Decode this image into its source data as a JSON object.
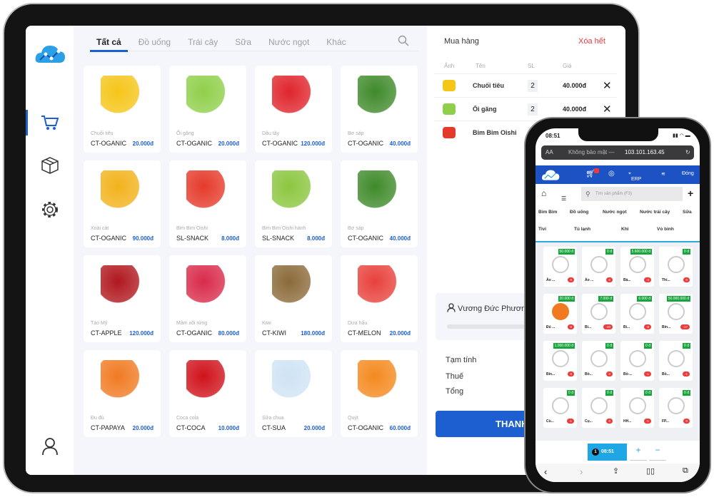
{
  "colors": {
    "accent": "#1d5fd1",
    "danger": "#f03a3a",
    "price_badge": "#17a63c",
    "phone_nav": "#1d52c4"
  },
  "sidebar": {
    "items": [
      {
        "icon": "cart-icon",
        "active": true
      },
      {
        "icon": "box-icon"
      },
      {
        "icon": "gear-icon"
      }
    ],
    "bottom_icon": "user-icon"
  },
  "tabs": [
    "Tất cả",
    "Đồ uống",
    "Trái cây",
    "Sữa",
    "Nước ngọt",
    "Khác"
  ],
  "products": [
    {
      "name": "Chuối tiêu",
      "code": "CT-OGANIC",
      "price": "20.000đ",
      "color": "#f5c518"
    },
    {
      "name": "Ổi găng",
      "code": "CT-OGANIC",
      "price": "20.000đ",
      "color": "#8fcf4a"
    },
    {
      "name": "Dâu tây",
      "code": "CT-OGANIC",
      "price": "120.000đ",
      "color": "#e0242c"
    },
    {
      "name": "Bơ sáp",
      "code": "CT-OGANIC",
      "price": "40.000đ",
      "color": "#3f8a2a"
    },
    {
      "name": "Xoài cát",
      "code": "CT-OGANIC",
      "price": "90.000đ",
      "color": "#f2b21b"
    },
    {
      "name": "Bim Bim Oishi",
      "code": "SL-SNACK",
      "price": "8.000đ",
      "color": "#e53a2a"
    },
    {
      "name": "Bim Bim Oishi hành",
      "code": "SL-SNACK",
      "price": "8.000đ",
      "color": "#8cc63f"
    },
    {
      "name": "Bơ sáp",
      "code": "CT-OGANIC",
      "price": "40.000đ",
      "color": "#3f8a2a"
    },
    {
      "name": "Táo Mỹ",
      "code": "CT-APPLE",
      "price": "120.000đ",
      "color": "#b0181e"
    },
    {
      "name": "Mâm xôi rừng",
      "code": "CT-OGANIC",
      "price": "80.000đ",
      "color": "#d92b4a"
    },
    {
      "name": "Kiwi",
      "code": "CT-KIWI",
      "price": "180.000đ",
      "color": "#8b6a3a"
    },
    {
      "name": "Dưa hấu",
      "code": "CT-MELON",
      "price": "20.000đ",
      "color": "#e8413c"
    },
    {
      "name": "Đu đủ",
      "code": "CT-PAPAYA",
      "price": "20.000đ",
      "color": "#f07a22"
    },
    {
      "name": "Coca cola",
      "code": "CT-COCA",
      "price": "10.000đ",
      "color": "#d0121b"
    },
    {
      "name": "Sữa chua",
      "code": "CT-SUA",
      "price": "20.000đ",
      "color": "#cfe3f5"
    },
    {
      "name": "Quýt",
      "code": "CT-OGANIC",
      "price": "60.000đ",
      "color": "#f4891f"
    }
  ],
  "cart": {
    "title": "Mua hàng",
    "clear": "Xóa hết",
    "headers": [
      "Ảnh",
      "Tên",
      "SL",
      "Giá"
    ],
    "items": [
      {
        "name": "Chuối tiêu",
        "qty": "2",
        "price": "40.000đ",
        "color": "#f5c518"
      },
      {
        "name": "Ổi găng",
        "qty": "2",
        "price": "40.000đ",
        "color": "#8fcf4a"
      },
      {
        "name": "Bim Bim Oishi",
        "qty": "2",
        "price": "",
        "color": "#e53a2a"
      }
    ],
    "customer": "Vương Đức Phương",
    "subtotal": "Tạm tính",
    "tax": "Thuế",
    "total": "Tổng",
    "pay": "THANH"
  },
  "phone": {
    "time": "08:51",
    "url_prefix": "Không bảo mật —",
    "url": "103.101.163.45",
    "aa": "AA",
    "nav": {
      "erp": "ERP",
      "close": "Đóng"
    },
    "search_placeholder": "Tìm sản phẩm (F3)",
    "cats_row1": [
      "Bim Bim",
      "Đồ uống",
      "Nước ngọt",
      "Nước trái cây",
      "Sữa"
    ],
    "cats_row2": [
      "Tivi",
      "Tủ lạnh",
      "Khi",
      "Vỏ bình"
    ],
    "products": [
      {
        "price": "50.000 đ",
        "name": "Áo ...",
        "badge": "0"
      },
      {
        "price": "0 đ",
        "name": "Áo ...",
        "badge": "0"
      },
      {
        "price": "5.600.000 đ",
        "name": "Bà...",
        "badge": "-3"
      },
      {
        "price": "0 đ",
        "name": "Thi...",
        "badge": "0"
      },
      {
        "price": "20.000 đ",
        "name": "Đủ ...",
        "badge": "0",
        "color": "#f07a22"
      },
      {
        "price": "7.000 đ",
        "name": "Bi...",
        "badge": "-20"
      },
      {
        "price": "6.000 đ",
        "name": "Bi...",
        "badge": "-8"
      },
      {
        "price": "50.000.000 đ",
        "name": "Bin...",
        "badge": "-17"
      },
      {
        "price": "1.000.000 đ",
        "name": "Bin...",
        "badge": "0"
      },
      {
        "price": "0 đ",
        "name": "Bồ...",
        "badge": "0"
      },
      {
        "price": "0 đ",
        "name": "Bồ-...",
        "badge": "-1"
      },
      {
        "price": "0 đ",
        "name": "Bồ...",
        "badge": "-1"
      },
      {
        "price": "0 đ",
        "name": "Cù...",
        "badge": "-1"
      },
      {
        "price": "0 đ",
        "name": "Cụ...",
        "badge": "0"
      },
      {
        "price": "0 đ",
        "name": "HH...",
        "badge": "-1"
      },
      {
        "price": "0 đ",
        "name": "FP...",
        "badge": "0"
      }
    ],
    "order_tab": {
      "number": "1",
      "time": "08:51"
    },
    "plus": "+",
    "minus": "−"
  }
}
